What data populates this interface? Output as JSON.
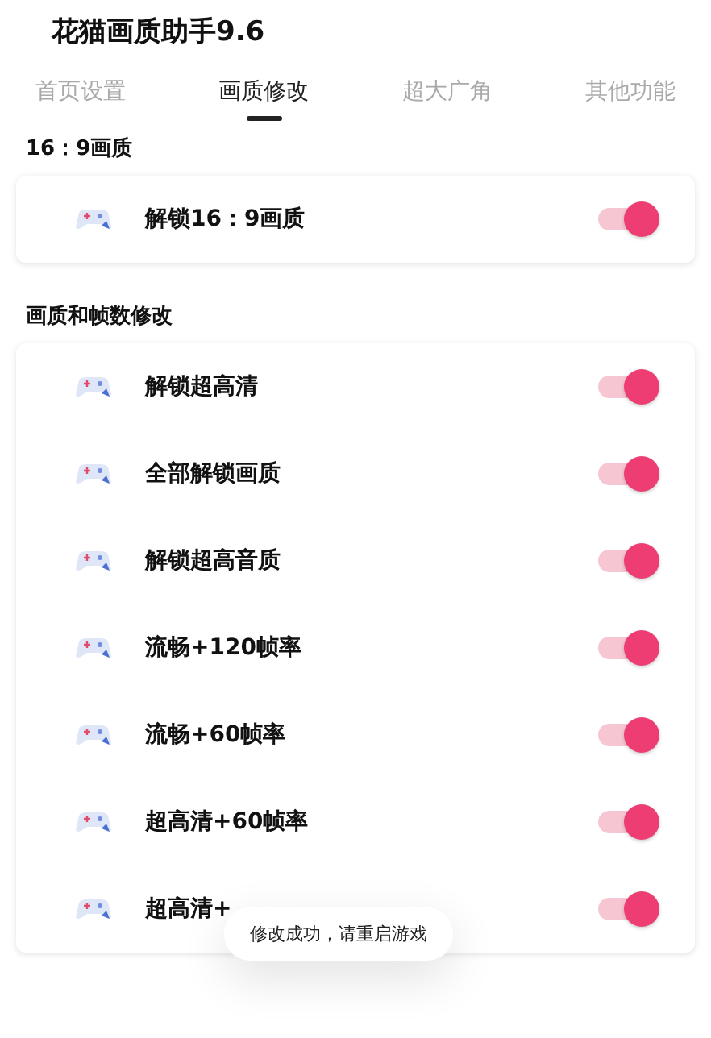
{
  "title": "花猫画质助手9.6",
  "tabs": [
    {
      "label": "首页设置",
      "selected": false
    },
    {
      "label": "画质修改",
      "selected": true
    },
    {
      "label": "超大广角",
      "selected": false
    },
    {
      "label": "其他功能",
      "selected": false
    }
  ],
  "sections": [
    {
      "heading": "16：9画质",
      "items": [
        {
          "label": "解锁16：9画质",
          "on": true
        }
      ]
    },
    {
      "heading": "画质和帧数修改",
      "items": [
        {
          "label": "解锁超高清",
          "on": true
        },
        {
          "label": "全部解锁画质",
          "on": true
        },
        {
          "label": "解锁超高音质",
          "on": true
        },
        {
          "label": "流畅+120帧率",
          "on": true
        },
        {
          "label": "流畅+60帧率",
          "on": true
        },
        {
          "label": "超高清+60帧率",
          "on": true
        },
        {
          "label": "超高清+",
          "on": true
        }
      ]
    }
  ],
  "toast": "修改成功，请重启游戏"
}
